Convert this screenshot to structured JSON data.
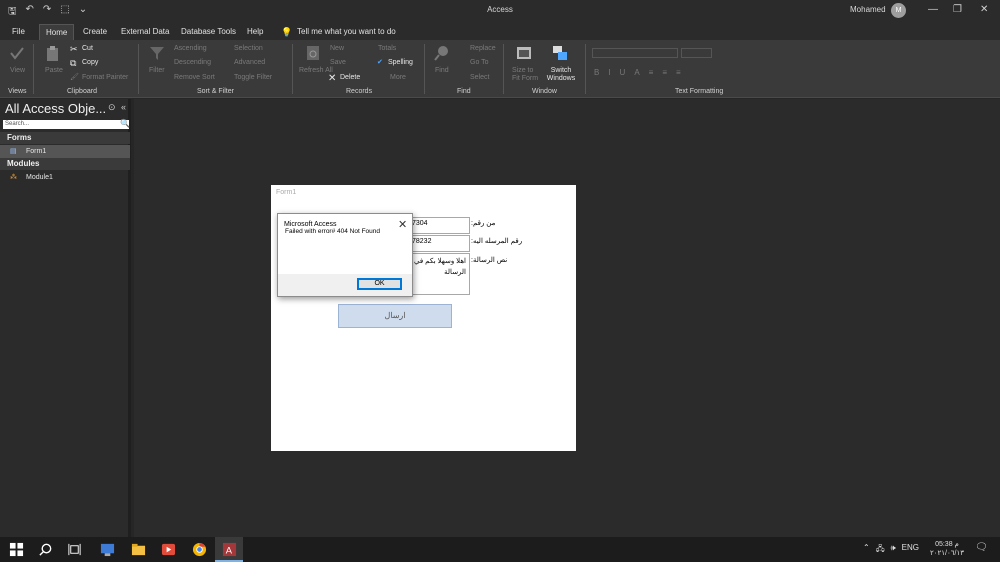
{
  "title_bar": {
    "app_title": "Access",
    "user_name": "Mohamed",
    "avatar_initial": "M",
    "window_controls": [
      "—",
      "❐",
      "✕"
    ]
  },
  "qat": [
    "🖫",
    "↶",
    "↷",
    "⬚",
    "⌄"
  ],
  "menu": {
    "tabs": [
      "File",
      "Home",
      "Create",
      "External Data",
      "Database Tools",
      "Help"
    ],
    "active_tab": "Home",
    "tell_me": "Tell me what you want to do"
  },
  "ribbon": {
    "views": {
      "label": "Views",
      "view": "View"
    },
    "clipboard": {
      "label": "Clipboard",
      "paste": "Paste",
      "cut": "Cut",
      "copy": "Copy",
      "format_painter": "Format Painter"
    },
    "sort_filter": {
      "label": "Sort & Filter",
      "filter": "Filter",
      "ascending": "Ascending",
      "descending": "Descending",
      "remove_sort": "Remove Sort",
      "selection": "Selection",
      "advanced": "Advanced",
      "toggle_filter": "Toggle Filter"
    },
    "records": {
      "label": "Records",
      "refresh": "Refresh All",
      "new": "New",
      "save": "Save",
      "delete": "Delete",
      "totals": "Totals",
      "spelling": "Spelling",
      "more": "More"
    },
    "find": {
      "label": "Find",
      "find": "Find",
      "replace": "Replace",
      "go_to": "Go To",
      "select": "Select"
    },
    "window": {
      "label": "Window",
      "size_to_fit": "Size to Fit Form",
      "switch_windows": "Switch Windows"
    },
    "text_formatting": {
      "label": "Text Formatting"
    }
  },
  "nav_pane": {
    "title": "All Access Obje...",
    "search_placeholder": "Search...",
    "sections": [
      {
        "name": "Forms",
        "items": [
          "Form1"
        ]
      },
      {
        "name": "Modules",
        "items": [
          "Module1"
        ]
      }
    ]
  },
  "form": {
    "title": "Form1",
    "from_number_label": "من رقم:",
    "from_number_value": "7304",
    "to_number_label": "رقم المرسله اليه:",
    "to_number_value": "78232",
    "message_label": "نص الرسالة:",
    "message_value": "اهلا وسهلا بكم في الرسالة",
    "send_button": "ارسال"
  },
  "dialog": {
    "title": "Microsoft Access",
    "message": "Failed with error# 404 Not Found",
    "ok": "OK"
  },
  "taskbar": {
    "language": "ENG",
    "time": "05:38 م",
    "date": "٢٠٢١/٠٦/١٣"
  },
  "colors": {
    "ribbon": "#3a3a3a",
    "workspace": "#2b2b2b",
    "accent_blue": "#0078d7",
    "access_red": "#a4373a"
  }
}
